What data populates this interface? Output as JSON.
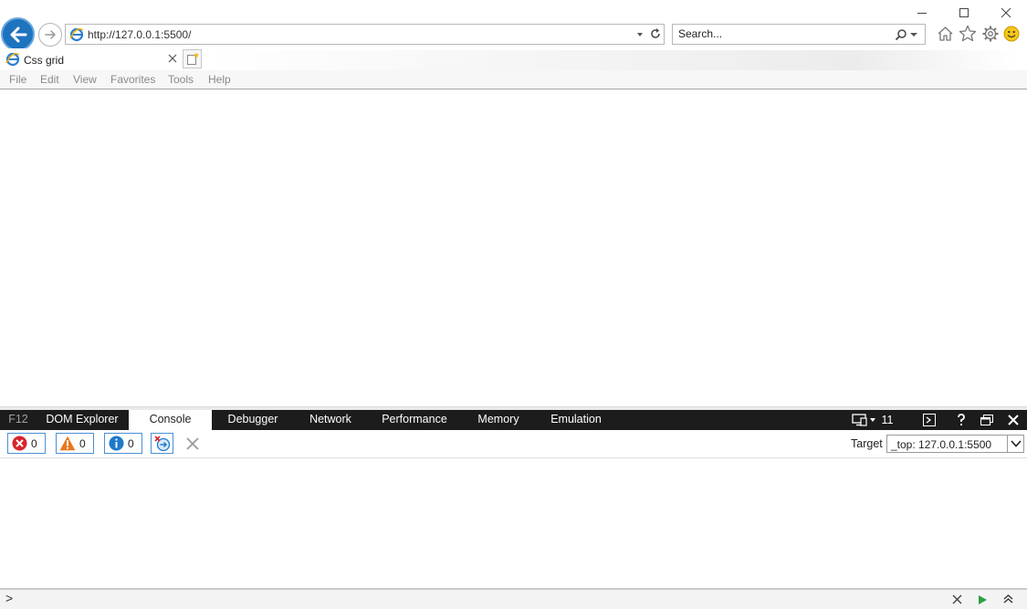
{
  "window": {
    "minimize_icon": "minimize-icon",
    "maximize_icon": "maximize-icon",
    "close_icon": "close-icon"
  },
  "nav": {
    "address": "http://127.0.0.1:5500/",
    "search_placeholder": "Search..."
  },
  "tab": {
    "title": "Css grid"
  },
  "menu": [
    "File",
    "Edit",
    "View",
    "Favorites",
    "Tools",
    "Help"
  ],
  "devtools": {
    "tabs": [
      "F12",
      "DOM Explorer",
      "Console",
      "Debugger",
      "Network",
      "Performance",
      "Memory",
      "Emulation"
    ],
    "active_tab": "Console",
    "document_mode": "11",
    "errors": "0",
    "warnings": "0",
    "messages": "0",
    "target_label": "Target",
    "target_value": "_top: 127.0.0.1:5500",
    "command_prompt": ">"
  },
  "colors": {
    "back_button": "#1e73be",
    "devtools_bar": "#1c1c1c",
    "error": "#d8242b",
    "warning": "#e8781e",
    "info": "#1e79c9",
    "run": "#2ea043"
  }
}
